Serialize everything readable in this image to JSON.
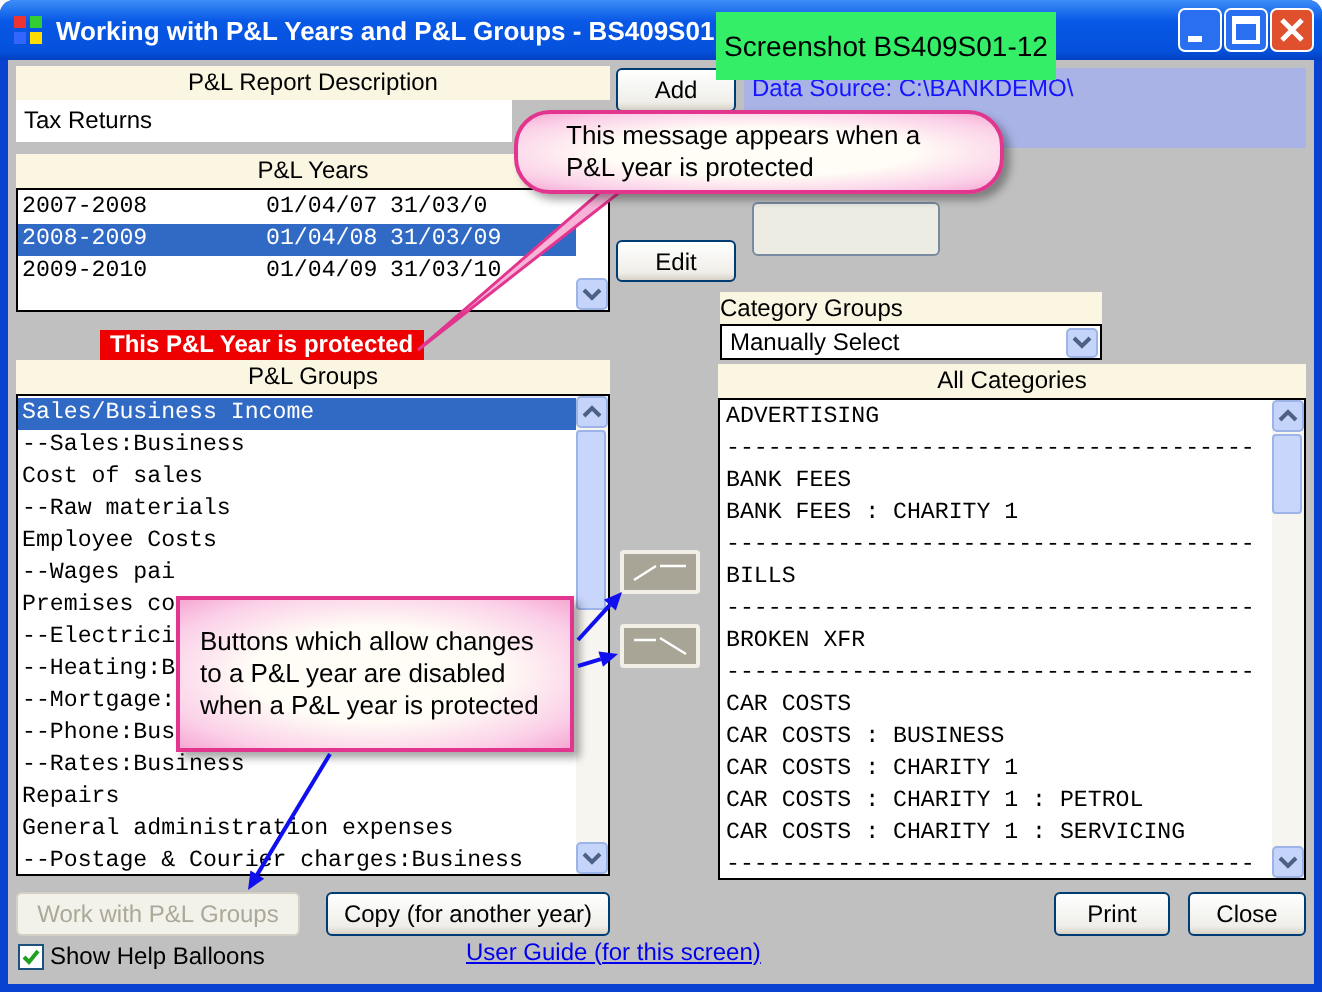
{
  "window": {
    "title": "Working with P&L Years and P&L Groups - BS409S01"
  },
  "screenshot_label": "Screenshot BS409S01-12",
  "report_description": {
    "header": "P&L Report Description",
    "value": "Tax Returns"
  },
  "years": {
    "header": "P&L Years",
    "rows": [
      {
        "name": "2007-2008",
        "start": "01/04/07",
        "end": "31/03/0",
        "selected": false
      },
      {
        "name": "2008-2009",
        "start": "01/04/08",
        "end": "31/03/09",
        "selected": true
      },
      {
        "name": "2009-2010",
        "start": "01/04/09",
        "end": "31/03/10",
        "selected": false
      }
    ]
  },
  "protected_message": "This P&L Year is protected",
  "groups": {
    "header": "P&L Groups",
    "rows": [
      {
        "text": "Sales/Business Income",
        "selected": true
      },
      {
        "text": "--Sales:Business",
        "selected": false
      },
      {
        "text": "Cost of sales",
        "selected": false
      },
      {
        "text": "--Raw materials",
        "selected": false
      },
      {
        "text": "Employee Costs",
        "selected": false
      },
      {
        "text": "--Wages pai",
        "selected": false
      },
      {
        "text": "Premises co",
        "selected": false
      },
      {
        "text": "--Electrici",
        "selected": false
      },
      {
        "text": "--Heating:B",
        "selected": false
      },
      {
        "text": "--Mortgage:",
        "selected": false
      },
      {
        "text": "--Phone:Bus",
        "selected": false
      },
      {
        "text": "--Rates:Business",
        "selected": false
      },
      {
        "text": "Repairs",
        "selected": false
      },
      {
        "text": "General administration expenses",
        "selected": false
      },
      {
        "text": "--Postage & Courier charges:Business",
        "selected": false
      }
    ]
  },
  "buttons": [
    {
      "label": "Add",
      "disabled": false
    },
    {
      "label": "Edit",
      "disabled": false
    }
  ],
  "move_buttons": [
    {
      "disabled": true
    },
    {
      "disabled": true
    }
  ],
  "data_source": "Data Source: C:\\BANKDEMO\\",
  "category_groups": {
    "label": "Category Groups",
    "value": "Manually Select"
  },
  "categories": {
    "header": "All Categories",
    "rows": [
      "ADVERTISING",
      "--------------------------------------",
      "BANK FEES",
      "BANK FEES : CHARITY 1",
      "--------------------------------------",
      "BILLS",
      "--------------------------------------",
      "BROKEN XFR",
      "--------------------------------------",
      "CAR COSTS",
      "CAR COSTS : BUSINESS",
      "CAR COSTS : CHARITY 1",
      "CAR COSTS : CHARITY 1 : PETROL",
      "CAR COSTS : CHARITY 1 : SERVICING",
      "--------------------------------------"
    ]
  },
  "bottom_buttons": [
    {
      "label": "Work with P&L Groups",
      "disabled": true
    },
    {
      "label": "Copy (for another year)",
      "disabled": false
    }
  ],
  "action_buttons": [
    {
      "label": "Print",
      "disabled": false
    },
    {
      "label": "Close",
      "disabled": false
    }
  ],
  "show_help": {
    "label": "Show Help Balloons",
    "checked": true
  },
  "link": "User Guide (for this screen)",
  "callouts": [
    {
      "text": "This message appears when a P&L year is protected"
    },
    {
      "text": "Buttons which allow changes to a P&L year are disabled when a P&L year is protected"
    }
  ]
}
